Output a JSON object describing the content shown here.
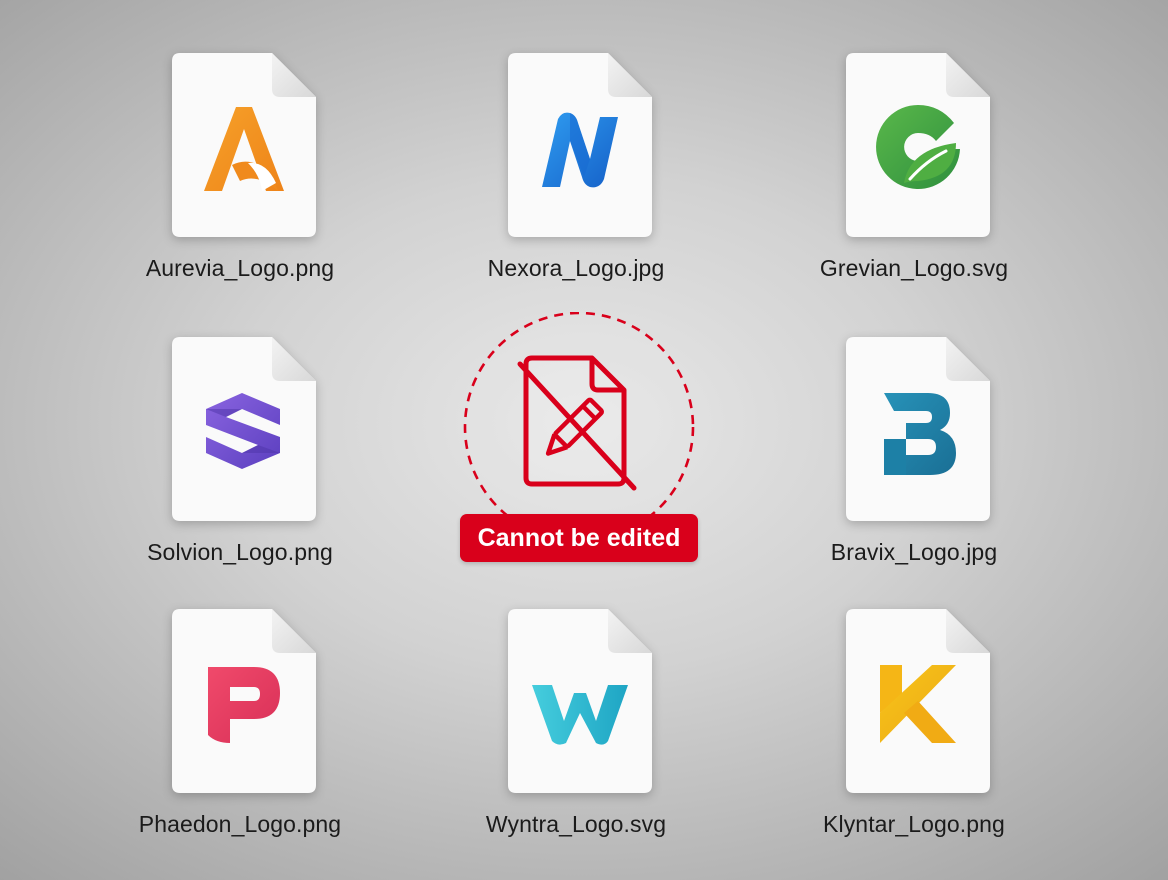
{
  "files": [
    {
      "name": "Aurevia_Logo.png",
      "logo": "aurevia-a-logo-icon",
      "color": "#f39221"
    },
    {
      "name": "Nexora_Logo.jpg",
      "logo": "nexora-n-logo-icon",
      "color": "#1f7fe0"
    },
    {
      "name": "Grevian_Logo.svg",
      "logo": "grevian-g-leaf-logo-icon",
      "color": "#45a845"
    },
    {
      "name": "Solvion_Logo.png",
      "logo": "solvion-s-logo-icon",
      "color": "#7654cf"
    },
    {
      "name": "Bravix_Logo.jpg",
      "logo": "bravix-b-logo-icon",
      "color": "#1f86ab"
    },
    {
      "name": "Phaedon_Logo.png",
      "logo": "phaedon-p-logo-icon",
      "color": "#e83c62"
    },
    {
      "name": "Wyntra_Logo.svg",
      "logo": "wyntra-w-logo-icon",
      "color": "#2ebfd4"
    },
    {
      "name": "Klyntar_Logo.png",
      "logo": "klyntar-k-logo-icon",
      "color": "#f2b517"
    }
  ],
  "blocked": {
    "label": "Cannot be edited",
    "icon": "no-edit-file-icon",
    "color": "#d9001b"
  }
}
